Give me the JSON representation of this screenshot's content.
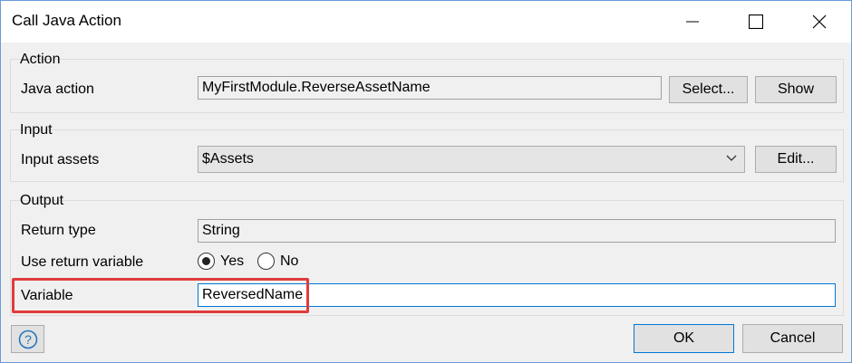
{
  "window": {
    "title": "Call Java Action"
  },
  "action": {
    "group_label": "Action",
    "java_action_label": "Java action",
    "java_action_value": "MyFirstModule.ReverseAssetName",
    "select_label": "Select...",
    "show_label": "Show"
  },
  "input": {
    "group_label": "Input",
    "input_assets_label": "Input assets",
    "input_assets_value": "$Assets",
    "edit_label": "Edit..."
  },
  "output": {
    "group_label": "Output",
    "return_type_label": "Return type",
    "return_type_value": "String",
    "use_return_label": "Use return variable",
    "yes_label": "Yes",
    "no_label": "No",
    "variable_label": "Variable",
    "variable_value": "ReversedName"
  },
  "footer": {
    "ok_label": "OK",
    "cancel_label": "Cancel"
  },
  "colors": {
    "highlight": "#e03c3c",
    "focus": "#0078d7",
    "help_icon": "#1e73be"
  }
}
